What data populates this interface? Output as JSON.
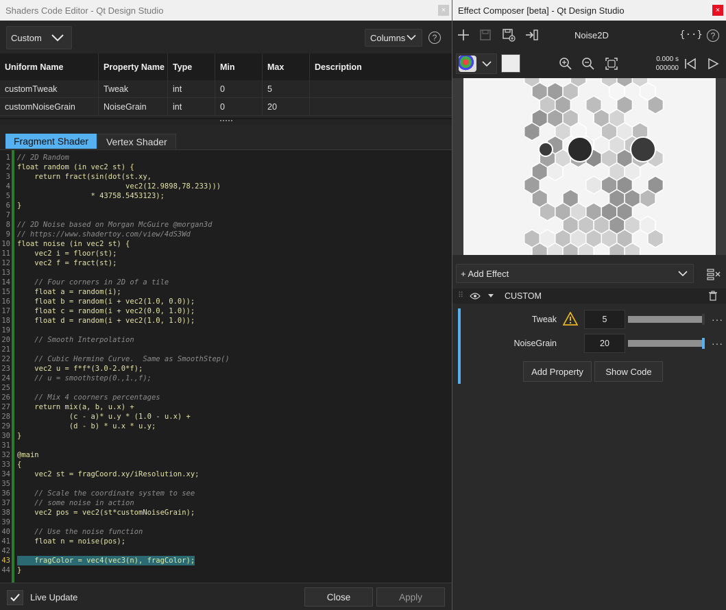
{
  "left_window": {
    "title": "Shaders Code Editor - Qt Design Studio",
    "close_glyph": "×",
    "mode_combo": "Custom",
    "columns_combo": "Columns",
    "help_glyph": "?",
    "table": {
      "headers": [
        "Uniform Name",
        "Property Name",
        "Type",
        "Min",
        "Max",
        "Description"
      ],
      "rows": [
        [
          "customTweak",
          "Tweak",
          "int",
          "0",
          "5",
          ""
        ],
        [
          "customNoiseGrain",
          "NoiseGrain",
          "int",
          "0",
          "20",
          ""
        ]
      ]
    },
    "tabs": [
      "Fragment Shader",
      "Vertex Shader"
    ],
    "active_tab": 0,
    "code_lines": [
      {
        "n": "1",
        "t": "// 2D Random",
        "c": true
      },
      {
        "n": "2",
        "t": "float random (in vec2 st) {"
      },
      {
        "n": "3",
        "t": "    return fract(sin(dot(st.xy,"
      },
      {
        "n": "4",
        "t": "                         vec2(12.9898,78.233)))"
      },
      {
        "n": "5",
        "t": "                 * 43758.5453123);"
      },
      {
        "n": "6",
        "t": "}"
      },
      {
        "n": "7",
        "t": ""
      },
      {
        "n": "8",
        "t": "// 2D Noise based on Morgan McGuire @morgan3d",
        "c": true
      },
      {
        "n": "9",
        "t": "// https://www.shadertoy.com/view/4dS3Wd",
        "c": true
      },
      {
        "n": "10",
        "t": "float noise (in vec2 st) {"
      },
      {
        "n": "11",
        "t": "    vec2 i = floor(st);"
      },
      {
        "n": "12",
        "t": "    vec2 f = fract(st);"
      },
      {
        "n": "13",
        "t": ""
      },
      {
        "n": "14",
        "t": "    // Four corners in 2D of a tile",
        "c": true
      },
      {
        "n": "15",
        "t": "    float a = random(i);"
      },
      {
        "n": "16",
        "t": "    float b = random(i + vec2(1.0, 0.0));"
      },
      {
        "n": "17",
        "t": "    float c = random(i + vec2(0.0, 1.0));"
      },
      {
        "n": "18",
        "t": "    float d = random(i + vec2(1.0, 1.0));"
      },
      {
        "n": "19",
        "t": ""
      },
      {
        "n": "20",
        "t": "    // Smooth Interpolation",
        "c": true
      },
      {
        "n": "21",
        "t": ""
      },
      {
        "n": "22",
        "t": "    // Cubic Hermine Curve.  Same as SmoothStep()",
        "c": true
      },
      {
        "n": "23",
        "t": "    vec2 u = f*f*(3.0-2.0*f);"
      },
      {
        "n": "24",
        "t": "    // u = smoothstep(0.,1.,f);",
        "c": true
      },
      {
        "n": "25",
        "t": ""
      },
      {
        "n": "26",
        "t": "    // Mix 4 coorners percentages",
        "c": true
      },
      {
        "n": "27",
        "t": "    return mix(a, b, u.x) +"
      },
      {
        "n": "28",
        "t": "            (c - a)* u.y * (1.0 - u.x) +"
      },
      {
        "n": "29",
        "t": "            (d - b) * u.x * u.y;"
      },
      {
        "n": "30",
        "t": "}"
      },
      {
        "n": "31",
        "t": ""
      },
      {
        "n": "32",
        "t": "@main"
      },
      {
        "n": "33",
        "t": "{"
      },
      {
        "n": "34",
        "t": "    vec2 st = fragCoord.xy/iResolution.xy;"
      },
      {
        "n": "35",
        "t": ""
      },
      {
        "n": "36",
        "t": "    // Scale the coordinate system to see",
        "c": true
      },
      {
        "n": "37",
        "t": "    // some noise in action",
        "c": true
      },
      {
        "n": "38",
        "t": "    vec2 pos = vec2(st*customNoiseGrain);"
      },
      {
        "n": "39",
        "t": ""
      },
      {
        "n": "40",
        "t": "    // Use the noise function",
        "c": true
      },
      {
        "n": "41",
        "t": "    float n = noise(pos);"
      },
      {
        "n": "42",
        "t": ""
      },
      {
        "n": "43",
        "t": "    fragColor = vec4(vec3(n), fragColor);",
        "hl": true
      },
      {
        "n": "44",
        "t": "}"
      }
    ],
    "live_update_label": "Live Update",
    "live_update_checked": true,
    "close_button": "Close",
    "apply_button": "Apply"
  },
  "right_window": {
    "title": "Effect Composer [beta] - Qt Design Studio",
    "close_glyph": "×",
    "composition_name": "Noise2D",
    "time_seconds": "0.000 s",
    "time_frames": "000000",
    "add_effect_label": "+ Add Effect",
    "section_title": "CUSTOM",
    "properties": [
      {
        "label": "Tweak",
        "value": "5",
        "fraction": 1.0,
        "warning": true
      },
      {
        "label": "NoiseGrain",
        "value": "20",
        "fraction": 1.0,
        "warning": false
      }
    ],
    "add_property_button": "Add Property",
    "show_code_button": "Show Code",
    "accent_color": "#56b1f0",
    "close_color": "#e81123"
  }
}
